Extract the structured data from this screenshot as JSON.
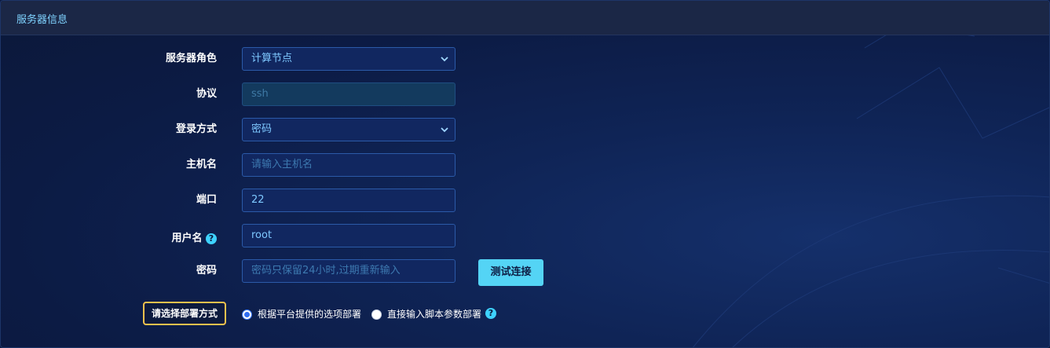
{
  "panel": {
    "title": "服务器信息"
  },
  "form": {
    "role": {
      "label": "服务器角色",
      "value": "计算节点"
    },
    "protocol": {
      "label": "协议",
      "value": "ssh"
    },
    "login_method": {
      "label": "登录方式",
      "value": "密码"
    },
    "hostname": {
      "label": "主机名",
      "placeholder": "请输入主机名"
    },
    "port": {
      "label": "端口",
      "value": "22"
    },
    "username": {
      "label": "用户名",
      "value": "root",
      "help": "?"
    },
    "password": {
      "label": "密码",
      "placeholder": "密码只保留24小时,过期重新输入"
    },
    "test_button": "测试连接"
  },
  "deploy": {
    "label": "请选择部署方式",
    "options": [
      {
        "label": "根据平台提供的选项部署",
        "selected": true
      },
      {
        "label": "直接输入脚本参数部署",
        "selected": false
      }
    ],
    "help": "?"
  }
}
